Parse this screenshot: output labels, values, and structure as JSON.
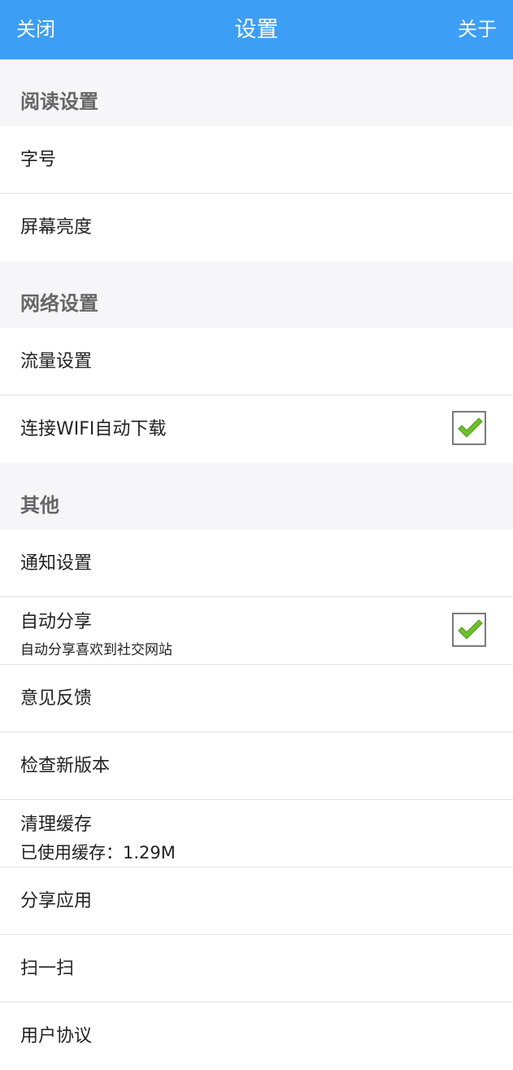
{
  "header": {
    "close_label": "关闭",
    "title": "设置",
    "about_label": "关于",
    "background": "#3d9ef5"
  },
  "sections": {
    "reading": {
      "title": "阅读设置",
      "font_size": "字号",
      "brightness": "屏幕亮度"
    },
    "network": {
      "title": "网络设置",
      "data_settings": "流量设置",
      "wifi_download": "连接WIFI自动下载",
      "wifi_download_checked": true
    },
    "other": {
      "title": "其他",
      "notification": "通知设置",
      "auto_share": "自动分享",
      "auto_share_desc": "自动分享喜欢到社交网站",
      "auto_share_checked": true,
      "feedback": "意见反馈",
      "check_update": "检查新版本",
      "clear_cache": "清理缓存",
      "cache_used": "已使用缓存：1.29M",
      "share_app": "分享应用",
      "scan": "扫一扫",
      "user_agreement": "用户协议"
    }
  },
  "colors": {
    "check_green": "#6cc12a"
  }
}
